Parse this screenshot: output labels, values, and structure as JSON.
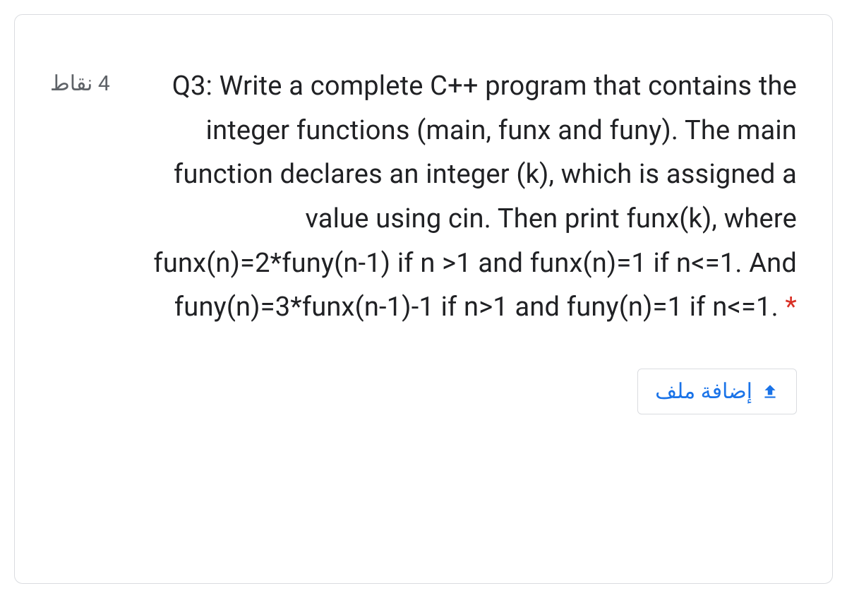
{
  "question": {
    "points_label": "4 نقاط",
    "text_part1": "Q3: Write a complete C++ program that contains the integer functions (main, funx and funy). The main function declares an integer (k), which is assigned a value using cin. Then print funx(k), where funx(n)=2*funy(n-1) if n >1 and funx(n)=1 if n<=1. And funy(n)=3*funx(n-1)-1 if n>1 and funy(n)=1 if n<=1.",
    "required_marker": " *"
  },
  "actions": {
    "add_file_label": "إضافة ملف"
  }
}
